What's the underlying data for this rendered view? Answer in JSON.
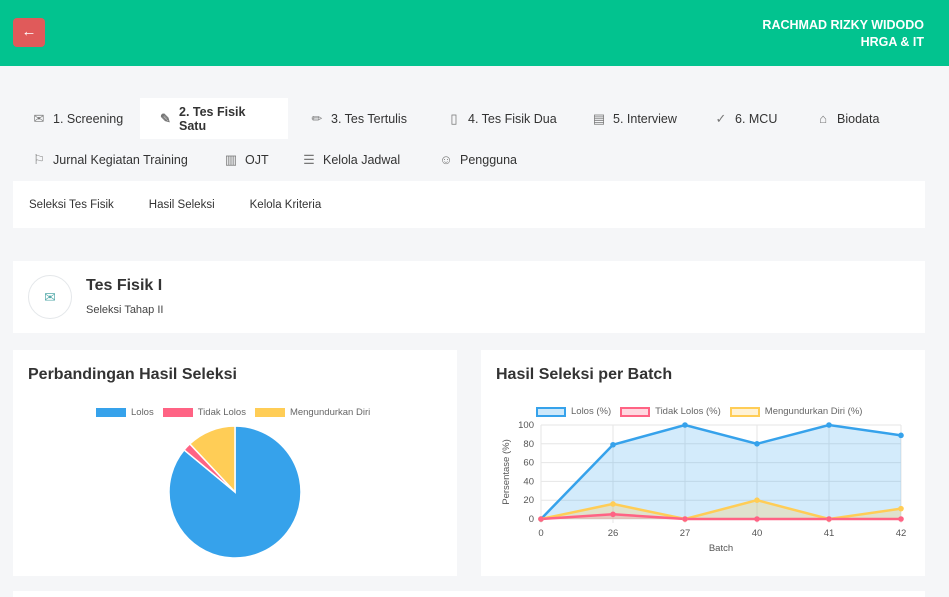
{
  "header": {
    "back_icon": "arrow-left-icon",
    "back_glyph": "←",
    "user_name": "RACHMAD RIZKY WIDODO",
    "user_dept": "HRGA & IT"
  },
  "tabs": [
    {
      "label": "1. Screening",
      "icon": "envelope-icon",
      "glyph": "✉"
    },
    {
      "label": "2. Tes Fisik Satu",
      "icon": "edit-icon",
      "glyph": "✎"
    },
    {
      "label": "3. Tes Tertulis",
      "icon": "pencil-icon",
      "glyph": "✏"
    },
    {
      "label": "4. Tes Fisik Dua",
      "icon": "film-icon",
      "glyph": "▯"
    },
    {
      "label": "5. Interview",
      "icon": "clipboard-icon",
      "glyph": "▤"
    },
    {
      "label": "6. MCU",
      "icon": "check-circle-icon",
      "glyph": "✓"
    },
    {
      "label": "Biodata",
      "icon": "inbox-icon",
      "glyph": "⌂"
    },
    {
      "label": "Jurnal Kegiatan Training",
      "icon": "flag-icon",
      "glyph": "⚐"
    },
    {
      "label": "OJT",
      "icon": "bar-chart-icon",
      "glyph": "▥"
    },
    {
      "label": "Kelola Jadwal",
      "icon": "list-circle-icon",
      "glyph": "☰"
    },
    {
      "label": "Pengguna",
      "icon": "user-icon",
      "glyph": "☺"
    }
  ],
  "subnav": [
    "Seleksi Tes Fisik",
    "Hasil Seleksi",
    "Kelola Kriteria"
  ],
  "page": {
    "icon": "envelope-icon",
    "glyph": "✉",
    "title": "Tes Fisik I",
    "subtitle": "Seleksi Tahap II"
  },
  "colors": {
    "primary": "#02c38f",
    "danger": "#e05a5a",
    "blue": "#36a2eb",
    "pink": "#ff6384",
    "yellow": "#ffcd56"
  },
  "chart_data": [
    {
      "type": "pie",
      "title": "Perbandingan Hasil Seleksi",
      "categories": [
        "Lolos",
        "Tidak Lolos",
        "Mengundurkan Diri"
      ],
      "values": [
        86,
        2,
        12
      ],
      "colors": [
        "#36a2eb",
        "#ff6384",
        "#ffcd56"
      ],
      "legend": "top"
    },
    {
      "type": "area",
      "title": "Hasil Seleksi per Batch",
      "xlabel": "Batch",
      "ylabel": "Persentase (%)",
      "categories": [
        "0",
        "26",
        "27",
        "40",
        "41",
        "42"
      ],
      "ylim": [
        0,
        100
      ],
      "yticks": [
        0,
        20,
        40,
        60,
        80,
        100
      ],
      "grid": true,
      "legend": "top",
      "series": [
        {
          "name": "Lolos (%)",
          "values": [
            0,
            79,
            100,
            80,
            100,
            89
          ],
          "color": "#36a2eb"
        },
        {
          "name": "Tidak Lolos (%)",
          "values": [
            0,
            5,
            0,
            0,
            0,
            0
          ],
          "color": "#ff6384"
        },
        {
          "name": "Mengundurkan Diri (%)",
          "values": [
            0,
            16,
            0,
            20,
            0,
            11
          ],
          "color": "#ffcd56"
        }
      ]
    }
  ]
}
